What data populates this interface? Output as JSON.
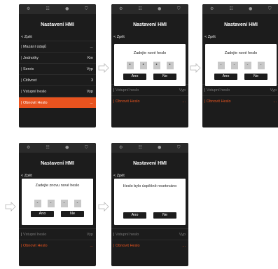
{
  "topbar": {
    "icons": [
      "gear-icon",
      "list-icon",
      "info-icon",
      "shield-icon"
    ],
    "glyphs": [
      "⚙",
      "☷",
      "●",
      "⛉"
    ]
  },
  "screen": {
    "title": "Nastavení HMI",
    "back_label": "< Zpět",
    "menu": [
      {
        "label": "Mazání údajů",
        "value": "..."
      },
      {
        "label": "Jednotky",
        "value": "Km"
      },
      {
        "label": "Servis",
        "value": "Vyp"
      },
      {
        "label": "Citlivost",
        "value": "3"
      },
      {
        "label": "Vstupní heslo",
        "value": "Vyp"
      },
      {
        "label": "Obnovit Heslo",
        "value": "..."
      }
    ]
  },
  "dialogs": {
    "enter_new": {
      "message": "Zadejte nové heslo",
      "digits": [
        "•",
        "•",
        "•",
        "•"
      ],
      "ok": "Ano",
      "cancel": "Ne"
    },
    "enter_new_dash": {
      "message": "Zadejte nové heslo",
      "digits": [
        "-",
        "-",
        "-",
        "-"
      ],
      "ok": "Ano",
      "cancel": "Ne"
    },
    "repeat_new": {
      "message": "Zadejte znovu nové heslo",
      "digits": [
        "-",
        "-",
        "-",
        "-"
      ],
      "ok": "Ano",
      "cancel": "Ne"
    },
    "success": {
      "message": "Heslo bylo úspěšně resetováno",
      "ok": "Ano",
      "cancel": "Ne"
    }
  },
  "colors": {
    "accent": "#e8531f",
    "background": "#1c1c1c",
    "dialog": "#ffffff"
  }
}
